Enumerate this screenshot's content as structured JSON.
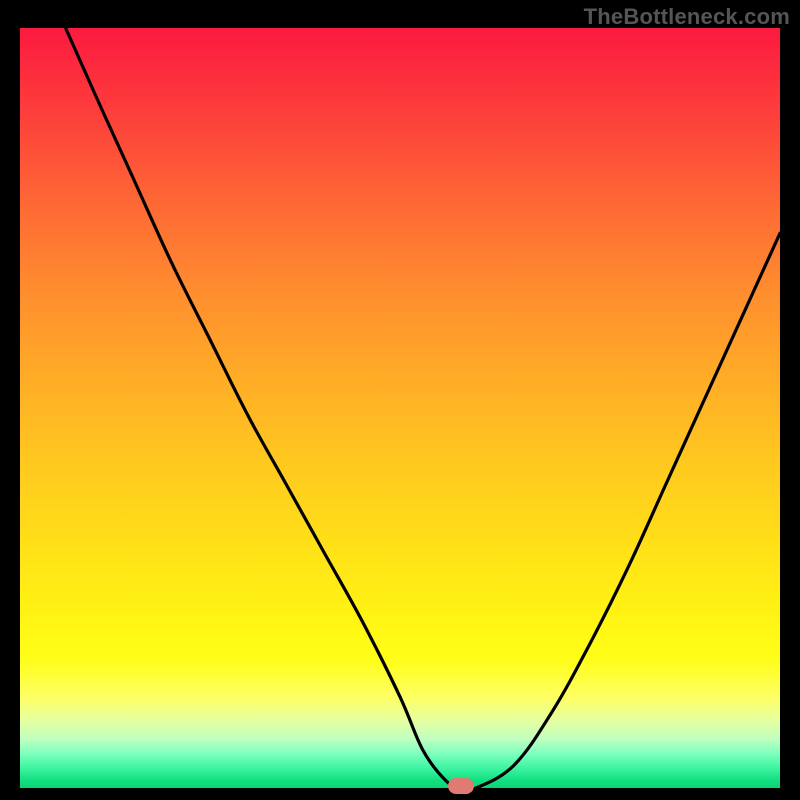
{
  "watermark": "TheBottleneck.com",
  "colors": {
    "frame": "#000000",
    "curve": "#000000",
    "marker": "#e07b74",
    "watermark": "#555555"
  },
  "chart_data": {
    "type": "line",
    "title": "",
    "xlabel": "",
    "ylabel": "",
    "xlim": [
      0,
      100
    ],
    "ylim": [
      0,
      100
    ],
    "grid": false,
    "legend": false,
    "gradient_stops": [
      {
        "pos": 0.0,
        "color": "#fb1a3f"
      },
      {
        "pos": 0.1,
        "color": "#fd3a3c"
      },
      {
        "pos": 0.24,
        "color": "#fe6b34"
      },
      {
        "pos": 0.34,
        "color": "#ff8b2f"
      },
      {
        "pos": 0.44,
        "color": "#ffa728"
      },
      {
        "pos": 0.57,
        "color": "#ffc81f"
      },
      {
        "pos": 0.68,
        "color": "#ffe018"
      },
      {
        "pos": 0.77,
        "color": "#fff313"
      },
      {
        "pos": 0.83,
        "color": "#fffe18"
      },
      {
        "pos": 0.88,
        "color": "#feff62"
      },
      {
        "pos": 0.91,
        "color": "#e7ff9f"
      },
      {
        "pos": 0.935,
        "color": "#c0ffc0"
      },
      {
        "pos": 0.955,
        "color": "#7dffbe"
      },
      {
        "pos": 0.975,
        "color": "#39f39e"
      },
      {
        "pos": 0.99,
        "color": "#12df80"
      },
      {
        "pos": 1.0,
        "color": "#0ad577"
      }
    ],
    "series": [
      {
        "name": "bottleneck-curve",
        "x": [
          6,
          10,
          15,
          20,
          25,
          30,
          35,
          40,
          45,
          50,
          53,
          56,
          58,
          60,
          65,
          70,
          75,
          80,
          85,
          90,
          95,
          100
        ],
        "y": [
          100,
          91,
          80,
          69,
          59,
          49,
          40,
          31,
          22,
          12,
          5,
          1,
          0,
          0,
          3,
          10,
          19,
          29,
          40,
          51,
          62,
          73
        ]
      }
    ],
    "flat_minimum": {
      "x_start": 55,
      "x_end": 61,
      "y": 0
    },
    "marker": {
      "x": 58,
      "y": 0,
      "width_pct": 3.5
    }
  }
}
